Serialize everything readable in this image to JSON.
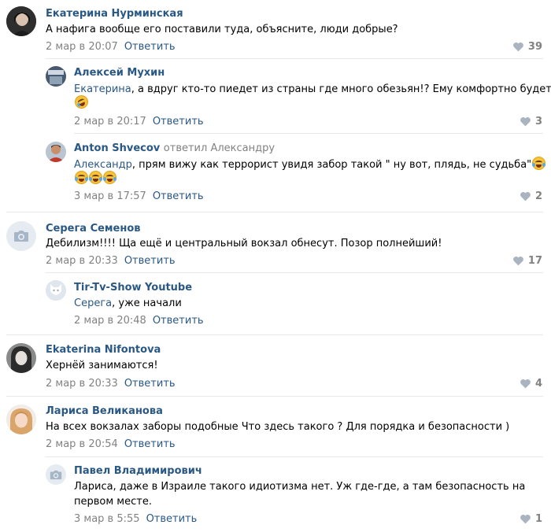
{
  "reply_label": "Ответить",
  "comments": [
    {
      "author": "Екатерина Нурминская",
      "text": "А нафига вообще его поставили туда, объясните, люди добрые?",
      "date": "2 мар в 20:07",
      "likes": "39",
      "avatar_icon": "user-photo-avatar"
    },
    {
      "author": "Алексей Мухин",
      "mention": "Екатерина",
      "text": ", а вдруг кто-то пиедет из страны где много обезьян!? Ему комфортно будет",
      "emoji": "rolling-laughing-emoji",
      "date": "2 мар в 20:17",
      "likes": "3",
      "avatar_icon": "user-photo-avatar"
    },
    {
      "author": "Anton Shvecov",
      "replied_to": "ответил Александру",
      "mention": "Александр",
      "text": ", прям вижу как террорист увидя забор такой \" ну вот, плядь, не судьба\"",
      "emoji": "tears-of-joy-emoji",
      "date": "3 мар в 17:57",
      "likes": "2",
      "avatar_icon": "user-photo-avatar"
    },
    {
      "author": "Серега Семенов",
      "text": "Дебилизм!!!! Ща ещё и центральный вокзал обнесут. Позор полнейший!",
      "date": "2 мар в 20:33",
      "likes": "17",
      "avatar_icon": "camera-placeholder-icon"
    },
    {
      "author": "Tir-Tv-Show Youtube",
      "mention": "Серега",
      "text": ", уже начали",
      "date": "2 мар в 20:48",
      "avatar_icon": "dog-logo-avatar"
    },
    {
      "author": "Ekaterina Nifontova",
      "text": "Хернёй занимаются!",
      "date": "2 мар в 20:33",
      "likes": "4",
      "avatar_icon": "user-photo-avatar"
    },
    {
      "author": "Лариса Великанова",
      "text": "На всех вокзалах заборы подобные Что здесь такого ? Для порядка и безопасности )",
      "date": "2 мар в 20:54",
      "avatar_icon": "user-photo-avatar"
    },
    {
      "author": "Павел Владимирович",
      "text_line1": "Лариса, даже в Израиле такого идиотизма нет. Уж где-где, а там безопасность на",
      "text_line2": "первом месте.",
      "date": "3 мар в 5:55",
      "likes": "1",
      "avatar_icon": "camera-placeholder-icon"
    }
  ],
  "colors": {
    "link": "#2a5885",
    "meta": "#828282",
    "separator": "#e7e8ec"
  }
}
